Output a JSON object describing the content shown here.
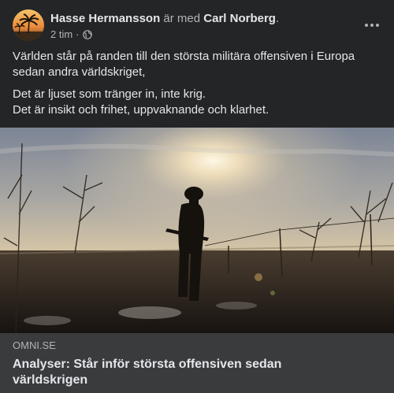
{
  "post": {
    "author": "Hasse Hermansson",
    "with_text": "är med",
    "tagged": "Carl Norberg",
    "tagged_suffix": ".",
    "time": "2 tim",
    "time_separator": "·",
    "privacy_icon": "globe-icon",
    "paragraphs": [
      "Världen står på randen till den största militära offensiven i Europa sedan andra världskriget,",
      "Det är ljuset som tränger in, inte krig.",
      "Det är insikt och frihet, uppvaknande och klarhet."
    ]
  },
  "link": {
    "domain": "OMNI.SE",
    "title": "Analyser: Står inför största offensiven sedan världskrigen"
  },
  "colors": {
    "background": "#242526",
    "card": "#3a3b3c",
    "text_primary": "#e4e6eb",
    "text_secondary": "#b0b3b8"
  }
}
